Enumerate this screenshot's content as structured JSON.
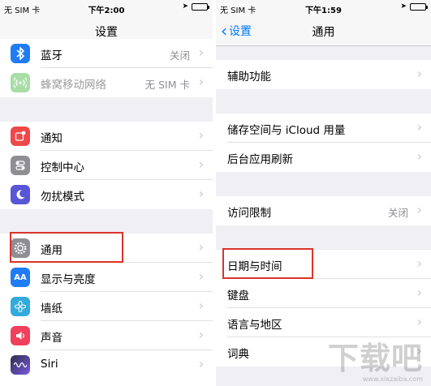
{
  "left": {
    "status": {
      "carrier": "无 SIM 卡",
      "time": "下午2:00"
    },
    "title": "设置",
    "rows": [
      {
        "label": "蓝牙",
        "value": "关闭",
        "icon": "bluetooth-icon",
        "color": "#1f7cf5"
      },
      {
        "label": "蜂窝移动网络",
        "value": "无 SIM 卡",
        "icon": "cellular-icon",
        "color": "#a9dda6"
      },
      {
        "label": "通知",
        "value": "",
        "icon": "notifications-icon",
        "color": "#f04848"
      },
      {
        "label": "控制中心",
        "value": "",
        "icon": "control-center-icon",
        "color": "#8e8e93"
      },
      {
        "label": "勿扰模式",
        "value": "",
        "icon": "moon-icon",
        "color": "#5856d6"
      },
      {
        "label": "通用",
        "value": "",
        "icon": "gear-icon",
        "color": "#8e8e93"
      },
      {
        "label": "显示与亮度",
        "value": "",
        "icon": "display-icon",
        "color": "#1f7cf5"
      },
      {
        "label": "墙纸",
        "value": "",
        "icon": "wallpaper-icon",
        "color": "#34aadc"
      },
      {
        "label": "声音",
        "value": "",
        "icon": "sound-icon",
        "color": "#f0405c"
      },
      {
        "label": "Siri",
        "value": "",
        "icon": "siri-icon",
        "color": "#2d2d4a"
      }
    ]
  },
  "right": {
    "status": {
      "carrier": "无 SIM 卡",
      "time": "下午1:59"
    },
    "back_label": "设置",
    "title": "通用",
    "rows": [
      {
        "label": "辅助功能",
        "value": ""
      },
      {
        "label": "储存空间与 iCloud 用量",
        "value": ""
      },
      {
        "label": "后台应用刷新",
        "value": ""
      },
      {
        "label": "访问限制",
        "value": "关闭"
      },
      {
        "label": "日期与时间",
        "value": ""
      },
      {
        "label": "键盘",
        "value": ""
      },
      {
        "label": "语言与地区",
        "value": ""
      },
      {
        "label": "词典",
        "value": ""
      }
    ]
  },
  "accent_color": "#007aff",
  "highlight_color": "#d9342b",
  "watermark": {
    "text": "下载吧",
    "url": "www.xiazaiba.com"
  }
}
